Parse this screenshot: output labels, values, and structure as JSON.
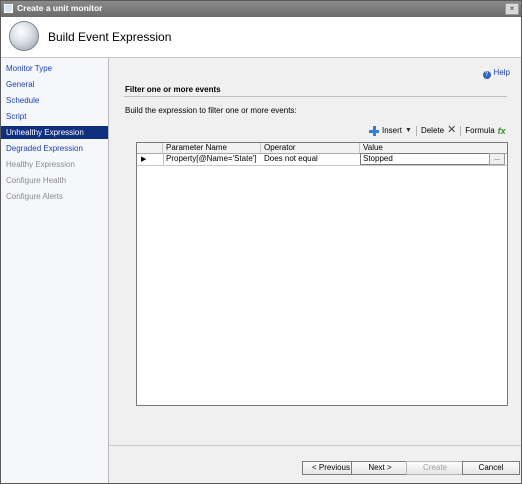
{
  "window": {
    "title": "Create a unit monitor",
    "close_glyph": "×"
  },
  "header": {
    "title": "Build Event Expression"
  },
  "sidebar": {
    "items": [
      {
        "label": "Monitor Type",
        "state": "link"
      },
      {
        "label": "General",
        "state": "link"
      },
      {
        "label": "Schedule",
        "state": "link"
      },
      {
        "label": "Script",
        "state": "link"
      },
      {
        "label": "Unhealthy Expression",
        "state": "selected"
      },
      {
        "label": "Degraded Expression",
        "state": "link"
      },
      {
        "label": "Healthy Expression",
        "state": "disabled"
      },
      {
        "label": "Configure Health",
        "state": "disabled"
      },
      {
        "label": "Configure Alerts",
        "state": "disabled"
      }
    ]
  },
  "main": {
    "help": "Help",
    "section_title": "Filter one or more events",
    "instructions": "Build the expression to filter one or more events:"
  },
  "toolbar": {
    "insert": "Insert",
    "delete": "Delete",
    "formula": "Formula",
    "icons": {
      "insert": "insert-icon",
      "delete": "delete-icon",
      "formula": "formula-icon"
    }
  },
  "grid": {
    "columns": [
      "Parameter Name",
      "Operator",
      "Value"
    ],
    "rows": [
      {
        "parameter_name": "Property[@Name='State']",
        "operator": "Does not equal",
        "value": "Stopped"
      }
    ],
    "ellipsis_button": "..."
  },
  "buttons": {
    "previous": "< Previous",
    "next": "Next >",
    "create": "Create",
    "cancel": "Cancel"
  }
}
